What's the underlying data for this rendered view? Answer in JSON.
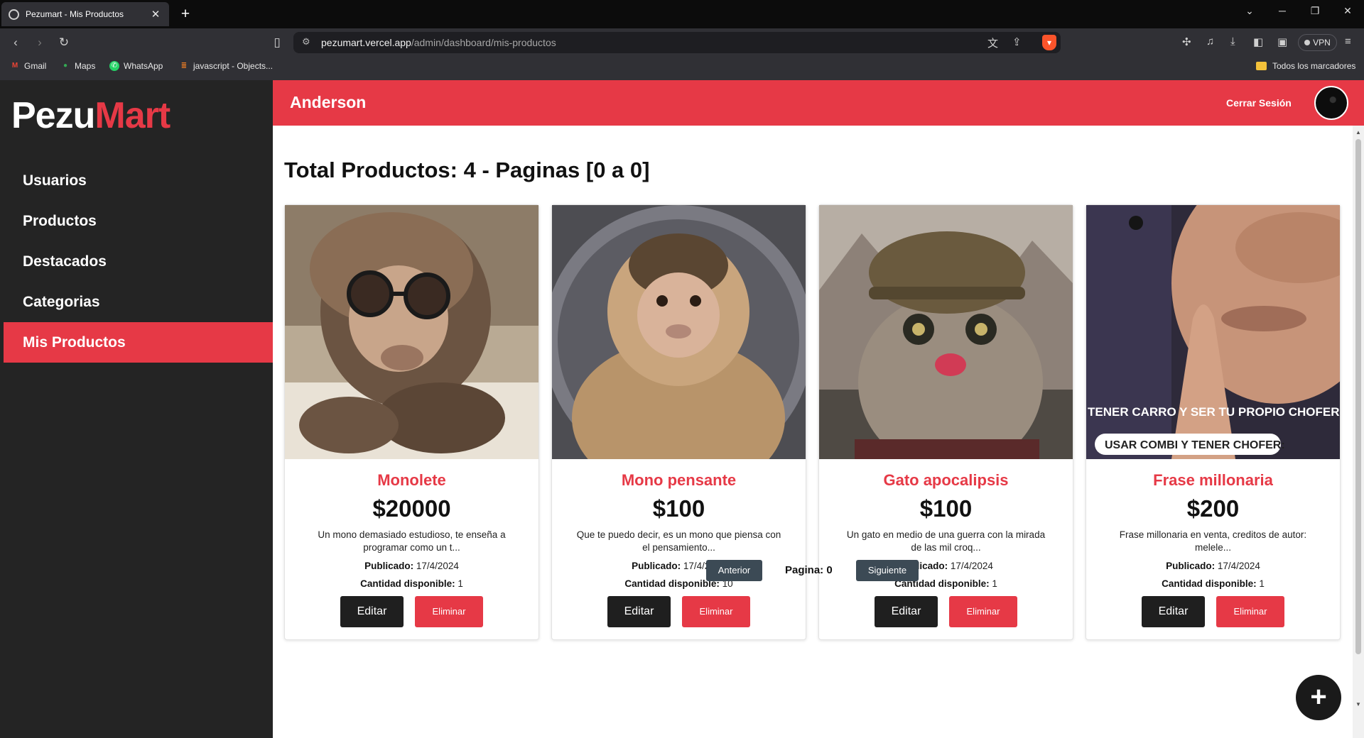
{
  "browser": {
    "tab_title": "Pezumart - Mis Productos",
    "tab_close": "✕",
    "new_tab": "+",
    "url_host": "pezumart.vercel.app",
    "url_path": "/admin/dashboard/mis-productos",
    "vpn_label": "VPN",
    "bookmarks": [
      "Gmail",
      "Maps",
      "WhatsApp",
      "javascript - Objects..."
    ],
    "all_bookmarks": "Todos los marcadores"
  },
  "app": {
    "logo_part1": "Pezu",
    "logo_part2": "Mart",
    "brand_color": "#e63946",
    "user_name": "Anderson",
    "logout_label": "Cerrar Sesión",
    "menu": [
      {
        "label": "Usuarios",
        "active": false
      },
      {
        "label": "Productos",
        "active": false
      },
      {
        "label": "Destacados",
        "active": false
      },
      {
        "label": "Categorias",
        "active": false
      },
      {
        "label": "Mis Productos",
        "active": true
      }
    ],
    "heading": "Total Productos: 4 - Paginas [0 a 0]",
    "published_label": "Publicado:",
    "quantity_label": "Cantidad disponible:",
    "edit_label": "Editar",
    "delete_label": "Eliminar",
    "products": [
      {
        "name": "Monolete",
        "price": "$20000",
        "description": "Un mono demasiado estudioso, te enseña a programar como un t...",
        "published": "17/4/2024",
        "quantity": "1"
      },
      {
        "name": "Mono pensante",
        "price": "$100",
        "description": "Que te puedo decir, es un mono que piensa con el pensamiento...",
        "published": "17/4/2024",
        "quantity": "10"
      },
      {
        "name": "Gato apocalipsis",
        "price": "$100",
        "description": "Un gato en medio de una guerra con la mirada de las mil croq...",
        "published": "17/4/2024",
        "quantity": "1"
      },
      {
        "name": "Frase millonaria",
        "price": "$200",
        "description": "Frase millonaria en venta, creditos de autor: melele...",
        "published": "17/4/2024",
        "quantity": "1",
        "image_caption_1": "TENER CARRO Y SER TU PROPIO CHOFER:",
        "image_caption_2": "USAR COMBI Y TENER CHOFER:"
      }
    ],
    "pager": {
      "prev_label": "Anterior",
      "page_label": "Pagina: 0",
      "next_label": "Siguiente"
    },
    "fab_label": "+"
  }
}
